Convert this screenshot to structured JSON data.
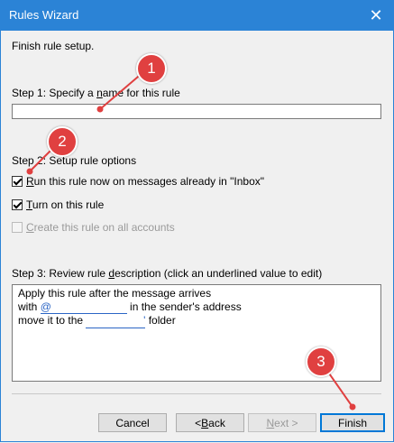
{
  "window": {
    "title": "Rules Wizard",
    "close_glyph": "✕"
  },
  "header": {
    "subtitle": "Finish rule setup."
  },
  "step1": {
    "label_pre": "Step 1: Specify a ",
    "label_mnemonic": "n",
    "label_post": "ame for this rule",
    "name_value": ""
  },
  "step2": {
    "label": "Step 2: Setup rule options",
    "options": [
      {
        "mnemonic": "R",
        "rest": "un this rule now on messages already in \"Inbox\"",
        "checked": true,
        "enabled": true
      },
      {
        "mnemonic": "T",
        "rest": "urn on this rule",
        "checked": true,
        "enabled": true
      },
      {
        "mnemonic": "C",
        "rest": "reate this rule on all accounts",
        "checked": false,
        "enabled": false
      }
    ]
  },
  "step3": {
    "label_pre": "Step 3: Review rule ",
    "label_mnemonic": "d",
    "label_post": "escription (click an underlined value to edit)",
    "line1": "Apply this rule after the message arrives",
    "line2_pre": "with ",
    "line2_link": "@",
    "line2_post": " in the sender's address",
    "line3_pre": "move it to the ",
    "line3_link": "'",
    "line3_post": " folder"
  },
  "buttons": {
    "cancel": "Cancel",
    "back_pre": "< ",
    "back_mnemonic": "B",
    "back_post": "ack",
    "next_mnemonic": "N",
    "next_post": "ext >",
    "finish": "Finish"
  },
  "callouts": [
    "1",
    "2",
    "3"
  ],
  "colors": {
    "titlebar": "#2b83d6",
    "callout": "#e04040",
    "link": "#2b65c5",
    "focus_border": "#0078d7"
  }
}
